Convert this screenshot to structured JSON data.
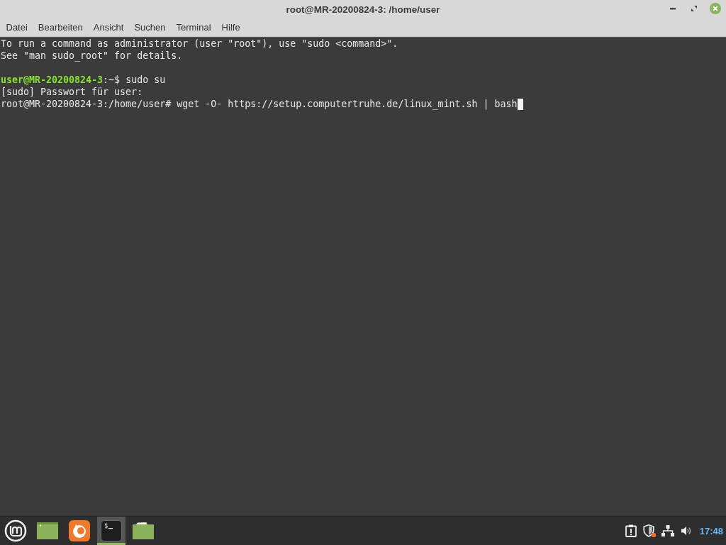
{
  "window": {
    "title": "root@MR-20200824-3: /home/user"
  },
  "menu": [
    {
      "label": "Datei"
    },
    {
      "label": "Bearbeiten"
    },
    {
      "label": "Ansicht"
    },
    {
      "label": "Suchen"
    },
    {
      "label": "Terminal"
    },
    {
      "label": "Hilfe"
    }
  ],
  "terminal": {
    "lines": [
      {
        "kind": "text",
        "cursor": false,
        "segments": [
          {
            "kind": "plain",
            "text": "To run a command as administrator (user \"root\"), use \"sudo <command>\"."
          }
        ]
      },
      {
        "kind": "text",
        "cursor": false,
        "segments": [
          {
            "kind": "plain",
            "text": "See \"man sudo_root\" for details."
          }
        ]
      },
      {
        "kind": "blank"
      },
      {
        "kind": "text",
        "cursor": false,
        "segments": [
          {
            "kind": "prompt",
            "text": "user@MR-20200824-3"
          },
          {
            "kind": "plain",
            "text": ":~$ sudo su"
          }
        ]
      },
      {
        "kind": "text",
        "cursor": false,
        "segments": [
          {
            "kind": "plain",
            "text": "[sudo] Passwort für user:"
          }
        ]
      },
      {
        "kind": "text",
        "cursor": true,
        "segments": [
          {
            "kind": "plain",
            "text": "root@MR-20200824-3:/home/user# wget -O- https://setup.computertruhe.de/linux_mint.sh | bash"
          }
        ]
      }
    ]
  },
  "taskbar": {
    "launchers": [
      {
        "kind": "desktop",
        "selected": false
      },
      {
        "kind": "browser",
        "selected": false
      },
      {
        "kind": "terminal",
        "selected": true
      },
      {
        "kind": "folder",
        "selected": false
      }
    ],
    "tray": [
      {
        "kind": "updates",
        "alert": false
      },
      {
        "kind": "shield",
        "alert": true
      },
      {
        "kind": "network",
        "alert": false
      },
      {
        "kind": "volume",
        "alert": false
      }
    ],
    "clock": "17:48"
  }
}
